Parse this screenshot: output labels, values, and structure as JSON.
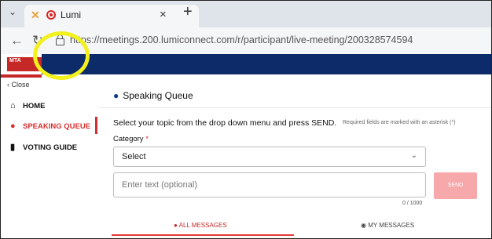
{
  "browser": {
    "tab_title": "Lumi",
    "tab_close": "×",
    "new_tab": "+",
    "url": "https://meetings.200.lumiconnect.com/r/participant/live-meeting/200328574594"
  },
  "sidebar": {
    "close_label": "Close",
    "items": [
      {
        "label": "HOME",
        "icon": "home-icon"
      },
      {
        "label": "SPEAKING QUEUE",
        "icon": "chat-icon"
      },
      {
        "label": "VOTING GUIDE",
        "icon": "document-icon"
      }
    ]
  },
  "panel": {
    "title": "Speaking Queue",
    "instruction": "Select your topic from the drop down menu and press SEND.",
    "required_note": "Required fields are marked with an asterisk (*)",
    "category_label": "Category",
    "category_required": "*",
    "select_value": "Select",
    "text_placeholder": "Enter text (optional)",
    "counter": "0 / 1000",
    "send_label": "SEND",
    "tabs": [
      {
        "label": "ALL MESSAGES"
      },
      {
        "label": "MY MESSAGES"
      }
    ]
  },
  "logo_text": "MTA",
  "colors": {
    "header_navy": "#0d2b69",
    "accent_red": "#d32f2f",
    "send_pink": "#f7a8aa",
    "highlight_yellow": "#f2f01d"
  }
}
